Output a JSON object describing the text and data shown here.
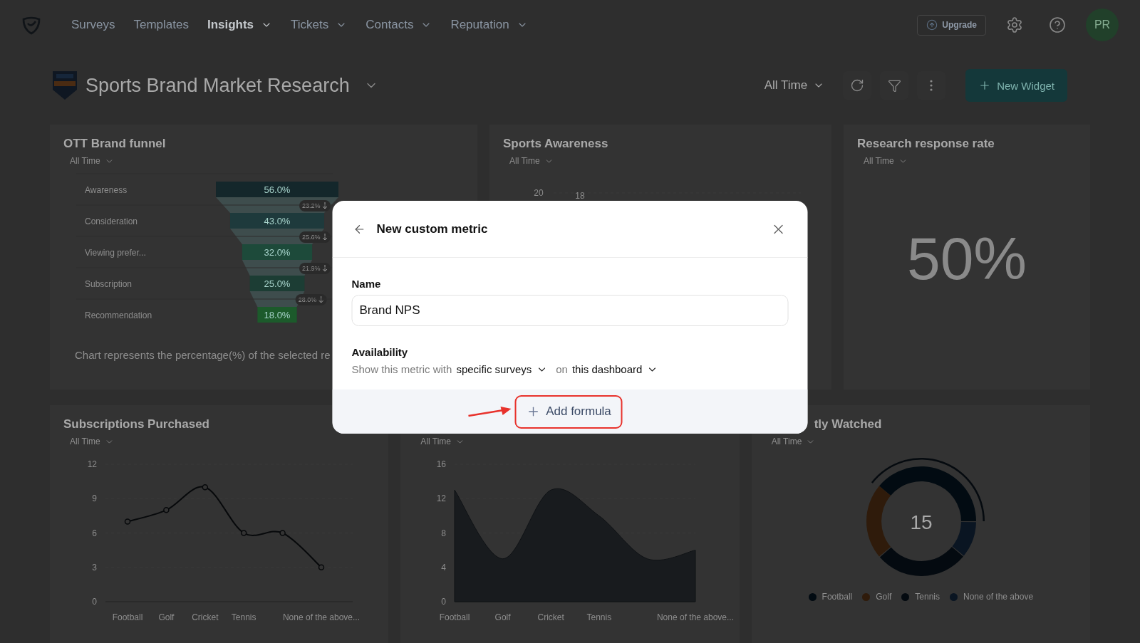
{
  "nav": {
    "items": [
      {
        "label": "Surveys",
        "selected": false,
        "dropdown": false
      },
      {
        "label": "Templates",
        "selected": false,
        "dropdown": false
      },
      {
        "label": "Insights",
        "selected": true,
        "dropdown": true
      },
      {
        "label": "Tickets",
        "selected": false,
        "dropdown": true
      },
      {
        "label": "Contacts",
        "selected": false,
        "dropdown": true
      },
      {
        "label": "Reputation",
        "selected": false,
        "dropdown": true
      }
    ],
    "upgrade": "Upgrade",
    "avatar": "PR"
  },
  "dashboard": {
    "title": "Sports Brand Market Research",
    "period": "All Time",
    "new_widget": "New Widget"
  },
  "rows": [
    {
      "widgets": [
        {
          "kind": "funnel",
          "title": "OTT Brand funnel",
          "filter": "All Time",
          "stages": [
            {
              "label": "Awareness",
              "value": "56.0%",
              "drop": "23.2%"
            },
            {
              "label": "Consideration",
              "value": "43.0%",
              "drop": "25.6%"
            },
            {
              "label": "Viewing prefer...",
              "value": "32.0%",
              "drop": "21.9%"
            },
            {
              "label": "Subscription",
              "value": "25.0%",
              "drop": "28.0%"
            },
            {
              "label": "Recommendation",
              "value": "18.0%"
            }
          ],
          "caption": "Chart represents the percentage(%) of the selected re"
        },
        {
          "kind": "fragment",
          "title": "Sports Awareness",
          "filter": "All Time",
          "visible_labels": [
            "20",
            "18"
          ]
        },
        {
          "kind": "metric",
          "title": "Research response rate",
          "filter": "All Time",
          "value": "50%"
        }
      ]
    },
    {
      "widgets": [
        {
          "kind": "line",
          "title": "Subscriptions Purchased",
          "filter": "All Time",
          "chart_data": {
            "type": "line",
            "categories": [
              "Football",
              "Golf",
              "Cricket",
              "Tennis",
              null,
              "None of the above..."
            ],
            "values": [
              7,
              8,
              10,
              6,
              6,
              3
            ],
            "marker": true,
            "ylim": [
              0,
              12
            ],
            "yticks": [
              0,
              3,
              6,
              9,
              12
            ]
          }
        },
        {
          "kind": "area",
          "filter": "All Time",
          "chart_data": {
            "type": "area",
            "categories": [
              "Football",
              "Golf",
              "Cricket",
              "Tennis",
              null,
              "None of the above..."
            ],
            "values": [
              13,
              5,
              13,
              10,
              5,
              6
            ],
            "ylim": [
              0,
              16
            ],
            "yticks": [
              0,
              4,
              8,
              12,
              16
            ]
          }
        },
        {
          "kind": "donut",
          "title": "tly Watched",
          "filter": "All Time",
          "center": "15",
          "legend": [
            {
              "label": "Football",
              "color": "#020b12"
            },
            {
              "label": "Golf",
              "color": "#2f1b0b"
            },
            {
              "label": "Tennis",
              "color": "#040a10"
            },
            {
              "label": "None of the above",
              "color": "#0a1522"
            }
          ]
        }
      ]
    }
  ],
  "modal": {
    "title": "New custom metric",
    "name_label": "Name",
    "name_value": "Brand NPS",
    "availability_label": "Availability",
    "availability": [
      {
        "kind": "text",
        "text": "Show this metric with"
      },
      {
        "kind": "dropdown",
        "text": "specific surveys"
      },
      {
        "kind": "text",
        "text": "on"
      },
      {
        "kind": "dropdown",
        "text": "this dashboard"
      }
    ],
    "action": "Add formula",
    "highlighted": true
  }
}
